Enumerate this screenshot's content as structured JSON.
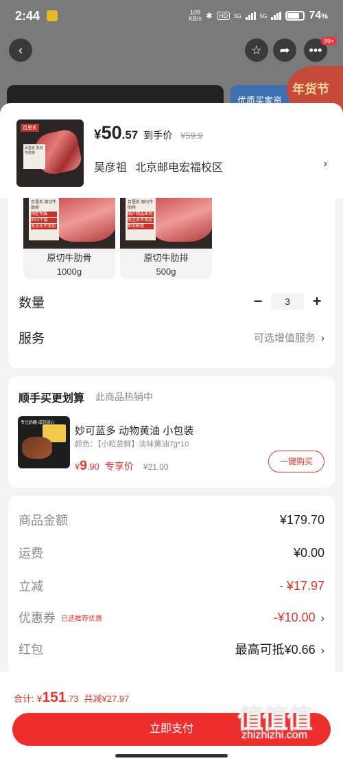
{
  "status": {
    "time": "2:44",
    "net_speed_value": "109",
    "net_speed_unit": "KB/s",
    "network_hd": "HD",
    "sig1": "5G",
    "sig2": "5G",
    "battery": "74",
    "battery_unit": "%"
  },
  "nav": {
    "back": "‹",
    "badge": "99+"
  },
  "background": {
    "banner_right_text": "优质买家资",
    "new_year_text": "年货节"
  },
  "product": {
    "thumb_tag": "百里炙",
    "thumb_box_text": "百里炙 原切牛肋排",
    "price_yen": "¥",
    "price_int": "50",
    "price_dec": ".57",
    "price_label": "到手价",
    "price_original": "¥59.9",
    "address_name": "吴彦祖",
    "address_place": "北京邮电宏福校区"
  },
  "variants": [
    {
      "name": "原切牛肋骨",
      "weight": "1000g",
      "box_title": "百里炙 原切牛肋骨",
      "box_hl1": "预定专属",
      "box_hl2": "4斤2个装",
      "box_hl3": "无法水不添加"
    },
    {
      "name": "原切牛肋排",
      "weight": "500g",
      "box_title": "百里炙 原切牛肋排",
      "box_hl1": "国产精选草饲",
      "box_hl2": "无注水不添加",
      "box_hl3": "即冻鲜锁"
    }
  ],
  "quantity": {
    "label": "数量",
    "minus": "−",
    "value": "3",
    "plus": "+"
  },
  "service": {
    "label": "服务",
    "value": "可选增值服务"
  },
  "upsell": {
    "title": "顺手买更划算",
    "subtitle": "此商品热销中",
    "thumb_caption": "专注奶酪 成的放心",
    "name": "妙可蓝多 动物黄油 小包装",
    "spec": "颜色：【小粒尝鲜】淡味黄油7g*10",
    "price_yen": "¥",
    "price_int": "9",
    "price_dec": ".90",
    "price_label": "专享价",
    "price_original": "¥21.00",
    "buy_label": "一键购买"
  },
  "price_details": {
    "goods_label": "商品金额",
    "goods_value": "¥179.70",
    "shipping_label": "运费",
    "shipping_value": "¥0.00",
    "discount_label": "立减",
    "discount_value": "- ¥17.97",
    "coupon_label": "优惠券",
    "coupon_tag": "已选推荐优惠",
    "coupon_value": "-¥10.00",
    "redpacket_label": "红包",
    "redpacket_value": "最高可抵¥0.66"
  },
  "bottom": {
    "total_label": "合计:",
    "total_yen": "¥",
    "total_int": "151",
    "total_dec": ".73",
    "total_saved": "共减¥27.97",
    "pay_label": "立即支付"
  },
  "watermark": {
    "logo": "值值值",
    "url": "zhizhizhi.com"
  },
  "colors": {
    "accent": "#ee2d2d",
    "price_red": "#e5352f",
    "sheet_bg": "#f3f3f3"
  },
  "icons": [
    "back-arrow-icon",
    "star-icon",
    "share-icon",
    "more-dots-icon",
    "close-icon",
    "chevron-right-icon",
    "minus-icon",
    "plus-icon"
  ]
}
